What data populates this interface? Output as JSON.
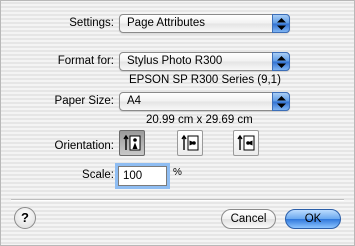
{
  "settings": {
    "label": "Settings:",
    "value": "Page Attributes"
  },
  "format_for": {
    "label": "Format for:",
    "value": "Stylus Photo R300",
    "printer_info": "EPSON SP R300 Series (9,1)"
  },
  "paper_size": {
    "label": "Paper Size:",
    "value": "A4",
    "dimensions": "20.99 cm x 29.69 cm"
  },
  "orientation": {
    "label": "Orientation:",
    "options": [
      "portrait-icon",
      "landscape-icon",
      "reverse-landscape-icon"
    ],
    "selected": "portrait-icon"
  },
  "scale": {
    "label": "Scale:",
    "value": "100",
    "unit": "%"
  },
  "buttons": {
    "help": "?",
    "cancel": "Cancel",
    "ok": "OK"
  },
  "colors": {
    "accent": "#3a7bd5",
    "focus_ring": "#8fbdf2"
  }
}
